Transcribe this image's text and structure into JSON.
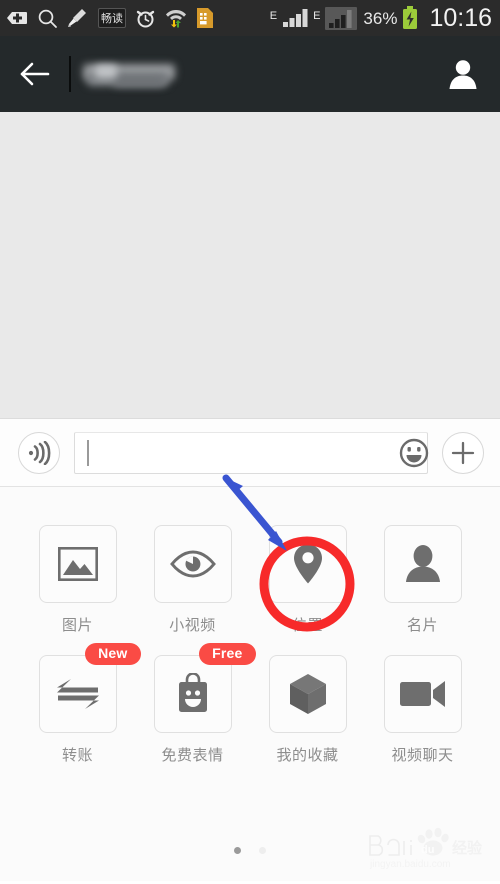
{
  "status_bar": {
    "time": "10:16",
    "battery_percent": "36%",
    "network_label_1": "E",
    "network_label_2": "E",
    "icons": [
      "add-tag-icon",
      "search-icon",
      "clean-sweep-icon",
      "changdu-app-icon",
      "alarm-clock-icon",
      "wifi-data-transfer-icon",
      "sim-card-icon",
      "signal-bars-icon-1",
      "signal-bars-icon-2",
      "battery-charging-icon"
    ],
    "app_badge_text": "畅读",
    "bar_color": "#2b2b2b"
  },
  "title_bar": {
    "back_label": "back",
    "contact_name": "",
    "contact_name_redacted": true,
    "profile_label": "contact profile",
    "bar_color": "#24292b"
  },
  "chat": {
    "background_color": "#e9e9e9",
    "messages": []
  },
  "input_bar": {
    "voice_button_label": "voice input",
    "text_value": "",
    "text_placeholder": "",
    "emoji_button_label": "emoji",
    "plus_button_label": "more"
  },
  "attachment_panel": {
    "background_color": "#fbfbfb",
    "rows": [
      [
        {
          "label": "图片",
          "icon": "photo-icon",
          "badge": null,
          "highlighted": false
        },
        {
          "label": "小视频",
          "icon": "eye-video-icon",
          "badge": null,
          "highlighted": false
        },
        {
          "label": "位置",
          "icon": "location-pin-icon",
          "badge": null,
          "highlighted": true
        },
        {
          "label": "名片",
          "icon": "person-card-icon",
          "badge": null,
          "highlighted": false
        }
      ],
      [
        {
          "label": "转账",
          "icon": "transfer-arrows-icon",
          "badge": "New",
          "highlighted": false
        },
        {
          "label": "免费表情",
          "icon": "sticker-smiley-icon",
          "badge": "Free",
          "highlighted": false
        },
        {
          "label": "我的收藏",
          "icon": "cube-favorites-icon",
          "badge": null,
          "highlighted": false
        },
        {
          "label": "视频聊天",
          "icon": "video-camera-icon",
          "badge": null,
          "highlighted": false
        }
      ]
    ],
    "badge_color": "#fa4b45",
    "page_dots": {
      "count": 2,
      "active_index": 0
    }
  },
  "annotations": {
    "highlight_circle_color": "#f72a2a",
    "arrow_color": "#3a55d1",
    "target": "位置"
  },
  "watermark": {
    "brand": "Baidu",
    "brand_suffix": "经验",
    "url": "jingyan.baidu.com"
  }
}
